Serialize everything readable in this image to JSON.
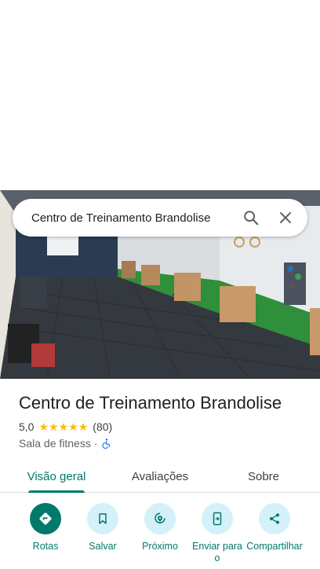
{
  "search": {
    "query": "Centro de Treinamento Brandolise"
  },
  "place": {
    "title": "Centro de Treinamento Brandolise",
    "rating": "5,0",
    "stars": 5,
    "review_count": "(80)",
    "category": "Sala de fitness",
    "separator": "·",
    "accessibility_icon": "wheelchair-icon"
  },
  "tabs": [
    {
      "label": "Visão geral",
      "active": true
    },
    {
      "label": "Avaliações",
      "active": false
    },
    {
      "label": "Sobre",
      "active": false
    }
  ],
  "actions": [
    {
      "label": "Rotas",
      "icon": "directions-icon"
    },
    {
      "label": "Salvar",
      "icon": "bookmark-icon"
    },
    {
      "label": "Próximo",
      "icon": "nearby-icon"
    },
    {
      "label": "Enviar para o",
      "icon": "send-to-phone-icon"
    },
    {
      "label": "Compartilhar",
      "icon": "share-icon"
    }
  ],
  "colors": {
    "accent": "#00796b",
    "action_bg": "#d4f1f9",
    "star": "#fbbc04"
  }
}
